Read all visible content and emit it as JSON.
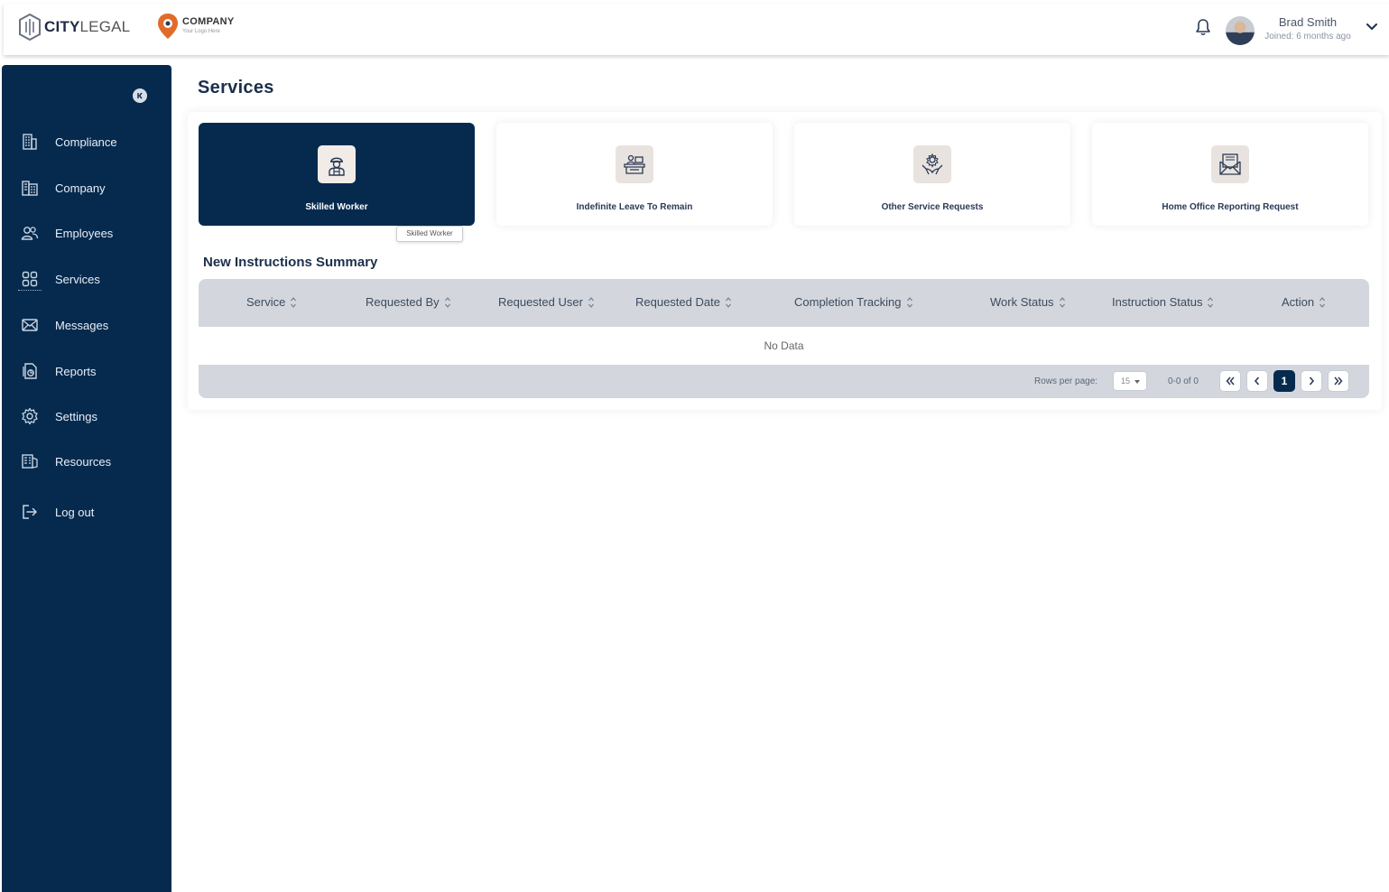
{
  "header": {
    "brand_bold": "CITY",
    "brand_light": "LEGAL",
    "company_name": "COMPANY",
    "company_tagline": "Your Logo Here",
    "user_name": "Brad Smith",
    "user_joined": "Joined: 6 months ago"
  },
  "sidebar": {
    "items": [
      {
        "label": "Compliance",
        "icon": "building-icon"
      },
      {
        "label": "Company",
        "icon": "office-icon"
      },
      {
        "label": "Employees",
        "icon": "users-icon"
      },
      {
        "label": "Services",
        "icon": "grid-icon"
      },
      {
        "label": "Messages",
        "icon": "mail-icon"
      },
      {
        "label": "Reports",
        "icon": "report-icon"
      },
      {
        "label": "Settings",
        "icon": "gear-icon"
      },
      {
        "label": "Resources",
        "icon": "resources-icon"
      },
      {
        "label": "Log out",
        "icon": "logout-icon"
      }
    ]
  },
  "main": {
    "title": "Services",
    "cards": [
      {
        "label": "Skilled Worker",
        "icon": "worker-icon",
        "active": true
      },
      {
        "label": "Indefinite Leave To Remain",
        "icon": "desk-icon"
      },
      {
        "label": "Other Service Requests",
        "icon": "hand-gear-icon"
      },
      {
        "label": "Home Office Reporting Request",
        "icon": "mail-report-icon"
      }
    ],
    "tooltip": "Skilled Worker",
    "section_title": "New Instructions Summary",
    "table": {
      "columns": [
        "Service",
        "Requested By",
        "Requested User",
        "Requested Date",
        "Completion Tracking",
        "Work Status",
        "Instruction Status",
        "Action"
      ],
      "empty_text": "No Data",
      "rows_per_page_label": "Rows per page:",
      "rows_per_page": "15",
      "range": "0-0 of 0",
      "current_page": "1"
    }
  },
  "colors": {
    "navy": "#052a4e",
    "table_header": "#d3d7dd"
  }
}
